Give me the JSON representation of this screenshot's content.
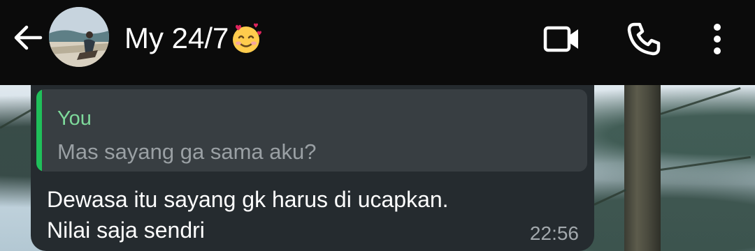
{
  "header": {
    "contact_name": "My 24/7",
    "back_icon": "arrow-left-icon",
    "video_icon": "video-camera-icon",
    "call_icon": "phone-icon",
    "menu_icon": "more-vertical-icon",
    "name_emoji": "smiling-face-with-hearts-icon"
  },
  "message": {
    "quoted_author": "You",
    "quoted_text": "Mas sayang ga sama aku?",
    "text": "Dewasa itu sayang gk harus di ucapkan.\nNilai saja sendri",
    "time": "22:56"
  },
  "colors": {
    "header_bg": "#0b0b0b",
    "bubble_bg": "#252b2f",
    "quote_bg": "#383e42",
    "quote_accent": "#1fbf5a",
    "quote_author": "#7ed99b"
  }
}
